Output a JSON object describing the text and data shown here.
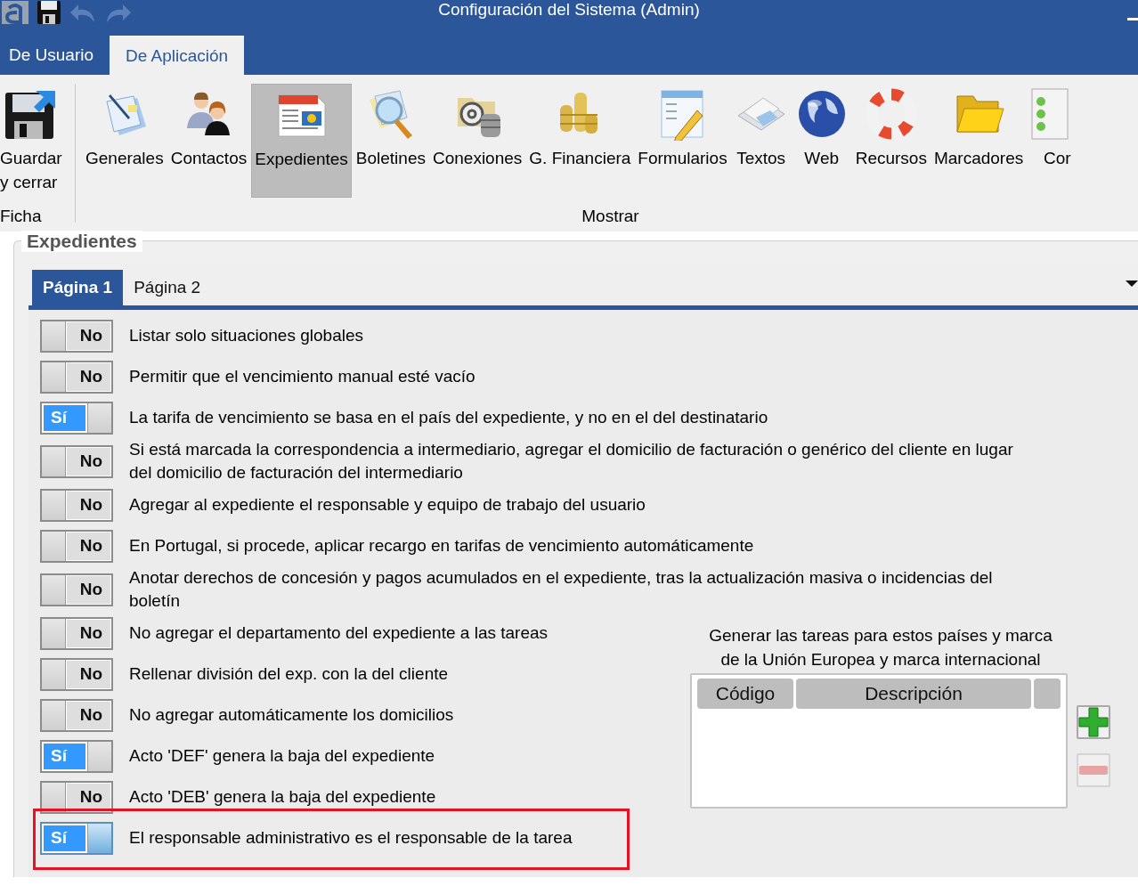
{
  "window": {
    "title": "Configuración del Sistema (Admin)"
  },
  "ribbon_tabs": [
    {
      "label": "De Usuario",
      "selected": false
    },
    {
      "label": "De Aplicación",
      "selected": true
    }
  ],
  "ribbon_groups": [
    {
      "label": "Ficha",
      "buttons": [
        {
          "label": "Guardar y cerrar",
          "selected": false
        }
      ]
    },
    {
      "label": "Mostrar",
      "buttons": [
        {
          "label": "Generales",
          "selected": false
        },
        {
          "label": "Contactos",
          "selected": false
        },
        {
          "label": "Expedientes",
          "selected": true
        },
        {
          "label": "Boletines",
          "selected": false
        },
        {
          "label": "Conexiones",
          "selected": false
        },
        {
          "label": "G. Financiera",
          "selected": false
        },
        {
          "label": "Formularios",
          "selected": false
        },
        {
          "label": "Textos",
          "selected": false
        },
        {
          "label": "Web",
          "selected": false
        },
        {
          "label": "Recursos",
          "selected": false
        },
        {
          "label": "Marcadores",
          "selected": false
        },
        {
          "label": "Cor",
          "selected": false
        }
      ]
    }
  ],
  "section": {
    "title": "Expedientes",
    "tabs": [
      {
        "label": "Página 1",
        "selected": true
      },
      {
        "label": "Página 2",
        "selected": false
      }
    ],
    "options": [
      {
        "label": "Listar solo situaciones globales",
        "on": false,
        "toggle_text": "No",
        "highlighted": false
      },
      {
        "label": "Permitir que el vencimiento manual esté vacío",
        "on": false,
        "toggle_text": "No",
        "highlighted": false
      },
      {
        "label": "La tarifa de vencimiento se basa en el país del expediente, y no en el del destinatario",
        "on": true,
        "toggle_text": "Sí",
        "highlighted": false
      },
      {
        "label": "Si está marcada la correspondencia a intermediario, agregar el domicilio de facturación o genérico del cliente en lugar del domicilio de facturación del intermediario",
        "on": false,
        "toggle_text": "No",
        "highlighted": false
      },
      {
        "label": "Agregar al expediente el responsable y equipo de trabajo del usuario",
        "on": false,
        "toggle_text": "No",
        "highlighted": false
      },
      {
        "label": "En Portugal, si procede, aplicar recargo en tarifas de vencimiento automáticamente",
        "on": false,
        "toggle_text": "No",
        "highlighted": false
      },
      {
        "label": "Anotar derechos de concesión y pagos acumulados en el expediente, tras la actualización masiva o incidencias del boletín",
        "on": false,
        "toggle_text": "No",
        "highlighted": false
      },
      {
        "label": "No agregar el departamento del expediente a las tareas",
        "on": false,
        "toggle_text": "No",
        "highlighted": false
      },
      {
        "label": "Rellenar división del exp. con la del cliente",
        "on": false,
        "toggle_text": "No",
        "highlighted": false
      },
      {
        "label": "No agregar automáticamente los domicilios",
        "on": false,
        "toggle_text": "No",
        "highlighted": false
      },
      {
        "label": "Acto 'DEF' genera la baja del expediente",
        "on": true,
        "toggle_text": "Sí",
        "highlighted": false
      },
      {
        "label": "Acto 'DEB' genera la baja del expediente",
        "on": false,
        "toggle_text": "No",
        "highlighted": false
      },
      {
        "label": "El responsable administrativo es el responsable de la tarea",
        "on": true,
        "toggle_text": "Sí",
        "highlighted": true
      }
    ],
    "countries_panel": {
      "caption": "Generar las tareas para estos países y marca de la Unión Europea y marca internacional",
      "columns": [
        "Código",
        "Descripción"
      ],
      "add_disabled": false,
      "remove_disabled": true
    }
  }
}
